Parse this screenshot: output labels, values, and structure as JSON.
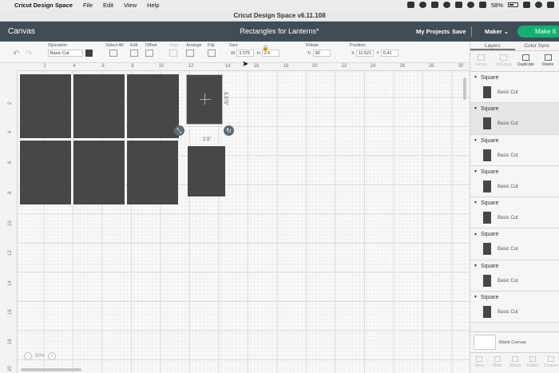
{
  "menubar": {
    "app_name": "Cricut Design Space",
    "items": [
      "File",
      "Edit",
      "View",
      "Help"
    ],
    "battery": "58%"
  },
  "window": {
    "title": "Cricut Design Space  v6.11.108"
  },
  "header": {
    "canvas_label": "Canvas",
    "project_title": "Rectangles for Lanterns*",
    "my_projects": "My Projects",
    "save": "Save",
    "machine": "Maker",
    "make_it": "Make It"
  },
  "toolbar": {
    "undo_icon": "undo-icon",
    "redo_icon": "redo-icon",
    "operation_label": "Operation",
    "operation_value": "Basic Cut",
    "select_all_label": "Select All",
    "edit_label": "Edit",
    "offset_label": "Offset",
    "align_label": "Align",
    "arrange_label": "Arrange",
    "flip_label": "Flip",
    "size_label": "Size",
    "w_label": "W",
    "w_value": "3.375",
    "h_label": "H",
    "h_value": "2.5",
    "rotate_label": "Rotate",
    "rotate_value": "90",
    "position_label": "Position",
    "x_label": "X",
    "x_value": "11.521",
    "y_label": "Y",
    "y_value": "0.41"
  },
  "rulers": {
    "top": [
      "2",
      "4",
      "6",
      "8",
      "10",
      "12",
      "14",
      "16",
      "18",
      "20",
      "22",
      "24",
      "26",
      "28",
      "30",
      "32"
    ],
    "left": [
      "2",
      "4",
      "6",
      "8",
      "10",
      "12",
      "14",
      "16",
      "18",
      "20"
    ]
  },
  "canvas": {
    "dim_vertical": "3.375\"",
    "dim_horizontal": "2.5\"",
    "zoom_value": "50%"
  },
  "panel": {
    "tabs": [
      "Layers",
      "Color Sync"
    ],
    "actions": [
      "Group",
      "UnGroup",
      "Duplicate",
      "Delete"
    ],
    "layers": [
      {
        "name": "Square",
        "operation": "Basic Cut"
      },
      {
        "name": "Square",
        "operation": "Basic Cut"
      },
      {
        "name": "Square",
        "operation": "Basic Cut"
      },
      {
        "name": "Square",
        "operation": "Basic Cut"
      },
      {
        "name": "Square",
        "operation": "Basic Cut"
      },
      {
        "name": "Square",
        "operation": "Basic Cut"
      },
      {
        "name": "Square",
        "operation": "Basic Cut"
      },
      {
        "name": "Square",
        "operation": "Basic Cut"
      }
    ],
    "blank_canvas": "Blank Canvas",
    "bottom_actions": [
      "Slice",
      "Weld",
      "Attach",
      "Flatten",
      "Contour"
    ]
  },
  "colors": {
    "header_bg": "#3f4d58",
    "make_it": "#14b06e",
    "shape_fill": "#454749"
  }
}
